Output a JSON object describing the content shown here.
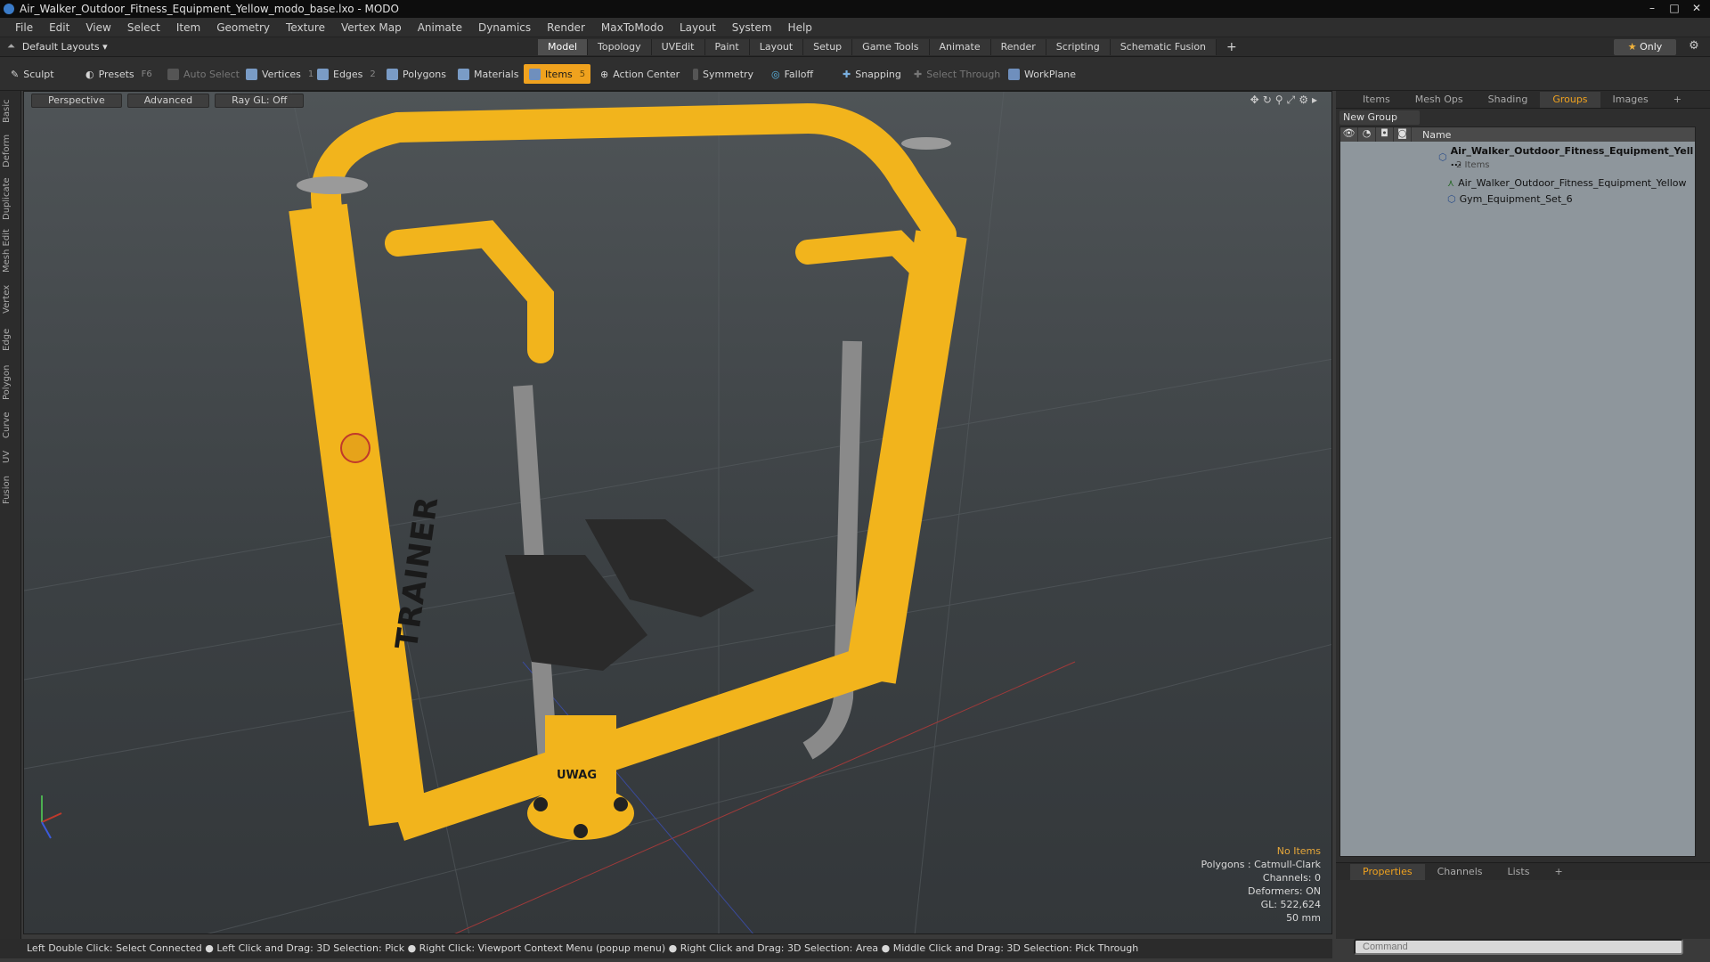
{
  "window": {
    "title": "Air_Walker_Outdoor_Fitness_Equipment_Yellow_modo_base.lxo - MODO",
    "minimize": "–",
    "maximize": "□",
    "close": "✕"
  },
  "menu": [
    "File",
    "Edit",
    "View",
    "Select",
    "Item",
    "Geometry",
    "Texture",
    "Vertex Map",
    "Animate",
    "Dynamics",
    "Render",
    "MaxToModo",
    "Layout",
    "System",
    "Help"
  ],
  "layouts": {
    "label": "Default Layouts ▾"
  },
  "mode_tabs": [
    {
      "label": "Model",
      "active": true
    },
    {
      "label": "Topology"
    },
    {
      "label": "UVEdit"
    },
    {
      "label": "Paint"
    },
    {
      "label": "Layout"
    },
    {
      "label": "Setup"
    },
    {
      "label": "Game Tools"
    },
    {
      "label": "Animate"
    },
    {
      "label": "Render"
    },
    {
      "label": "Scripting"
    },
    {
      "label": "Schematic Fusion"
    }
  ],
  "only_button": "Only",
  "toolbar": {
    "sculpt": "Sculpt",
    "presets": "Presets",
    "presets_key": "F6",
    "auto_select": "Auto Select",
    "vertices": "Vertices",
    "vertices_key": "1",
    "edges": "Edges",
    "edges_key": "2",
    "polygons": "Polygons",
    "materials": "Materials",
    "items": "Items",
    "items_key": "5",
    "action_center": "Action Center",
    "symmetry": "Symmetry",
    "falloff": "Falloff",
    "snapping": "Snapping",
    "select_through": "Select Through",
    "workplane": "WorkPlane"
  },
  "left_tabs": [
    "Basic",
    "Deform",
    "Duplicate",
    "Mesh Edit",
    "Vertex",
    "Edge",
    "Polygon",
    "Curve",
    "UV",
    "Fusion"
  ],
  "viewport": {
    "perspective": "Perspective",
    "advanced": "Advanced",
    "raygl": "Ray GL: Off",
    "trainer_text": "TRAINER",
    "base_text": "UWAG",
    "stats": {
      "no_items": "No Items",
      "polygons": "Polygons : Catmull-Clark",
      "channels": "Channels: 0",
      "deformers": "Deformers: ON",
      "gl": "GL: 522,624",
      "scale": "50 mm"
    }
  },
  "right_panel": {
    "tabs": [
      {
        "label": "Items"
      },
      {
        "label": "Mesh Ops"
      },
      {
        "label": "Shading"
      },
      {
        "label": "Groups",
        "active": true
      },
      {
        "label": "Images"
      }
    ],
    "new_group": "New Group",
    "name_header": "Name",
    "tree": {
      "group_name": "Air_Walker_Outdoor_Fitness_Equipment_Yell ...",
      "group_count": "2 Items",
      "child1": "Air_Walker_Outdoor_Fitness_Equipment_Yellow",
      "child2": "Gym_Equipment_Set_6"
    },
    "bottom_tabs": [
      {
        "label": "Properties",
        "active": true
      },
      {
        "label": "Channels"
      },
      {
        "label": "Lists"
      }
    ],
    "command_placeholder": "Command"
  },
  "status": "Left Double Click: Select Connected ● Left Click and Drag: 3D Selection: Pick ● Right Click: Viewport Context Menu (popup menu) ● Right Click and Drag: 3D Selection: Area ● Middle Click and Drag: 3D Selection: Pick Through",
  "colors": {
    "accent": "#f0a21e",
    "yellow_frame": "#f2b41c",
    "grey_tube": "#8a8a8a",
    "footplate": "#2a2a2a"
  }
}
